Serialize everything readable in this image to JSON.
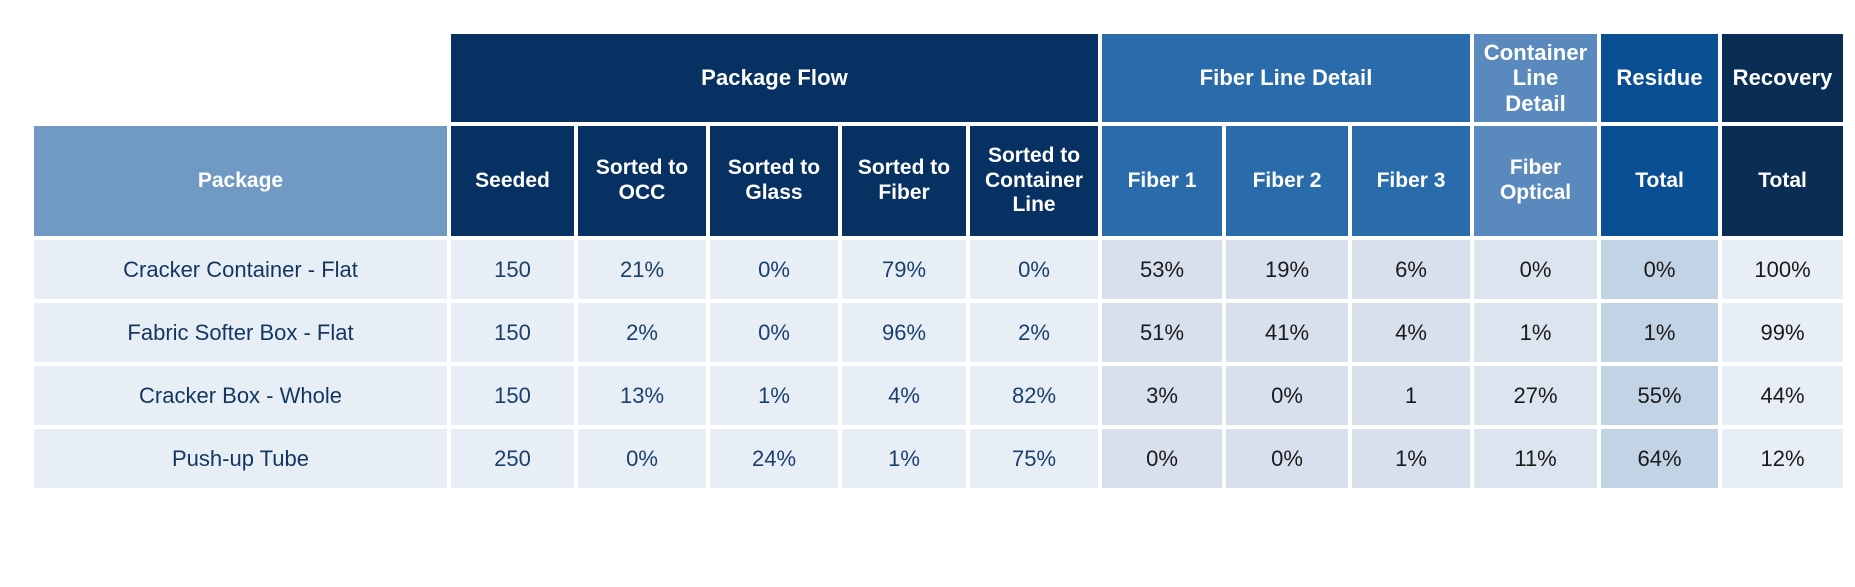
{
  "table": {
    "group_headers": [
      {
        "label": "",
        "span": 1,
        "key": "blank"
      },
      {
        "label": "Package Flow",
        "span": 5,
        "key": "package_flow"
      },
      {
        "label": "Fiber Line Detail",
        "span": 3,
        "key": "fiber_line_detail"
      },
      {
        "label": "Container Line Detail",
        "span": 1,
        "key": "container_line_detail"
      },
      {
        "label": "Residue",
        "span": 1,
        "key": "residue"
      },
      {
        "label": "Recovery",
        "span": 1,
        "key": "recovery"
      }
    ],
    "column_headers": [
      "Package",
      "Seeded",
      "Sorted to OCC",
      "Sorted to Glass",
      "Sorted to Fiber",
      "Sorted to Container Line",
      "Fiber 1",
      "Fiber 2",
      "Fiber 3",
      "Fiber Optical",
      "Total",
      "Total"
    ],
    "rows": [
      {
        "package": "Cracker Container - Flat",
        "seeded": "150",
        "sorted_to_occ": "21%",
        "sorted_to_glass": "0%",
        "sorted_to_fiber": "79%",
        "sorted_to_container_line": "0%",
        "fiber_1": "53%",
        "fiber_2": "19%",
        "fiber_3": "6%",
        "fiber_optical": "0%",
        "residue_total": "0%",
        "recovery_total": "100%"
      },
      {
        "package": "Fabric Softer Box - Flat",
        "seeded": "150",
        "sorted_to_occ": "2%",
        "sorted_to_glass": "0%",
        "sorted_to_fiber": "96%",
        "sorted_to_container_line": "2%",
        "fiber_1": "51%",
        "fiber_2": "41%",
        "fiber_3": "4%",
        "fiber_optical": "1%",
        "residue_total": "1%",
        "recovery_total": "99%"
      },
      {
        "package": "Cracker Box - Whole",
        "seeded": "150",
        "sorted_to_occ": "13%",
        "sorted_to_glass": "1%",
        "sorted_to_fiber": "4%",
        "sorted_to_container_line": "82%",
        "fiber_1": "3%",
        "fiber_2": "0%",
        "fiber_3": "1",
        "fiber_optical": "27%",
        "residue_total": "55%",
        "recovery_total": "44%"
      },
      {
        "package": "Push-up Tube",
        "seeded": "250",
        "sorted_to_occ": "0%",
        "sorted_to_glass": "24%",
        "sorted_to_fiber": "1%",
        "sorted_to_container_line": "75%",
        "fiber_1": "0%",
        "fiber_2": "0%",
        "fiber_3": "1%",
        "fiber_optical": "11%",
        "residue_total": "64%",
        "recovery_total": "12%"
      }
    ],
    "colors": {
      "package_flow_header": "#083163",
      "fiber_line_header": "#2a6cab",
      "container_line_header": "#5a89be",
      "residue_header": "#0a4e93",
      "recovery_header": "#0a2d55",
      "package_column_header": "#7099c4",
      "cell_light": "#e8eef6",
      "cell_fiber": "#d7e0ec",
      "cell_residue": "#c3d3e6",
      "label_text": "#13365f"
    }
  }
}
